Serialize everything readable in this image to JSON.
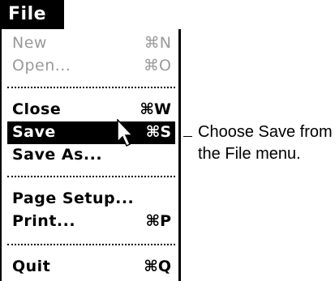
{
  "menu": {
    "title": "File",
    "items": [
      {
        "label": "New",
        "shortcut": "⌘N",
        "enabled": false
      },
      {
        "label": "Open...",
        "shortcut": "⌘O",
        "enabled": false
      },
      {
        "label": "Close",
        "shortcut": "⌘W",
        "enabled": true
      },
      {
        "label": "Save",
        "shortcut": "⌘S",
        "enabled": true,
        "selected": true
      },
      {
        "label": "Save As...",
        "shortcut": "",
        "enabled": true
      },
      {
        "label": "Page Setup...",
        "shortcut": "",
        "enabled": true
      },
      {
        "label": "Print...",
        "shortcut": "⌘P",
        "enabled": true
      },
      {
        "label": "Quit",
        "shortcut": "⌘Q",
        "enabled": true
      }
    ]
  },
  "callout": {
    "line1": "Choose Save from",
    "line2": "the File menu."
  },
  "icons": {
    "cursor": "arrow-cursor-icon"
  }
}
